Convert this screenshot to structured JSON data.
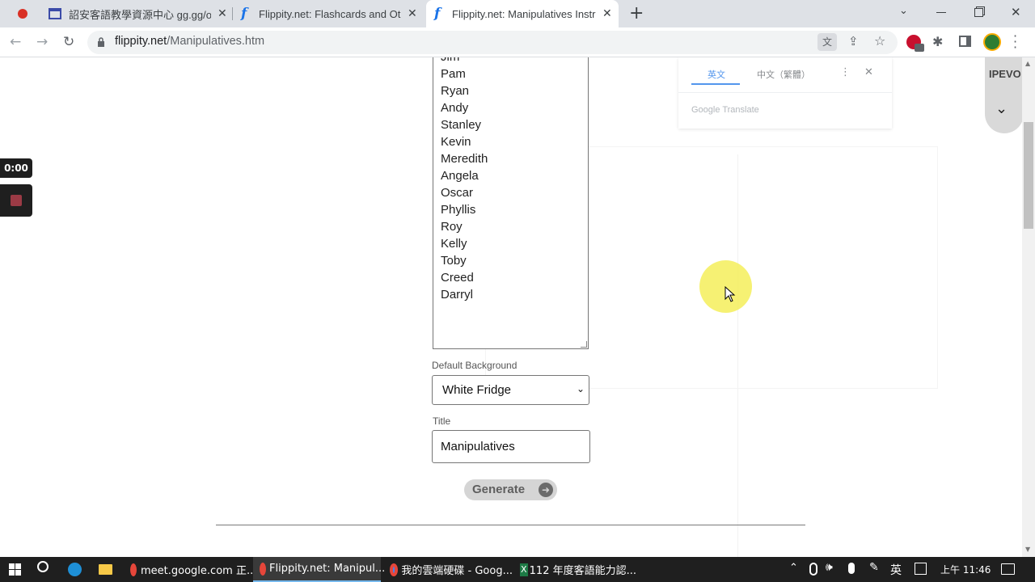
{
  "browser": {
    "tabs": [
      {
        "title": "詔安客語教學資源中心 gg.gg/oi"
      },
      {
        "title": "Flippity.net: Flashcards and Oth"
      },
      {
        "title": "Flippity.net: Manipulatives Instr"
      }
    ],
    "address": {
      "host": "flippity.net",
      "path": "/Manipulatives.htm"
    }
  },
  "translate_popup": {
    "tab_en": "英文",
    "tab_zh": "中文（繁體）",
    "brand": "Google Translate"
  },
  "ipevo": {
    "label": "IPEVO"
  },
  "recorder": {
    "time": "0:00"
  },
  "form": {
    "names": [
      "Jim",
      "Pam",
      "Ryan",
      "Andy",
      "Stanley",
      "Kevin",
      "Meredith",
      "Angela",
      "Oscar",
      "Phyllis",
      "Roy",
      "Kelly",
      "Toby",
      "Creed",
      "Darryl"
    ],
    "background_label": "Default Background",
    "background_value": "White Fridge",
    "title_label": "Title",
    "title_value": "Manipulatives",
    "generate_label": "Generate"
  },
  "taskbar": {
    "apps": [
      {
        "label": "meet.google.com 正..."
      },
      {
        "label": "Flippity.net: Manipul..."
      },
      {
        "label": "我的雲端硬碟 - Goog..."
      },
      {
        "label": "112 年度客語能力認..."
      }
    ],
    "ime": "英",
    "clock": "上午 11:46"
  },
  "colors": {
    "accent": "#1a73e8",
    "tabstrip": "#dee1e6",
    "taskbar": "#1f1f1f",
    "cursor_highlight": "#f5ee5a"
  }
}
